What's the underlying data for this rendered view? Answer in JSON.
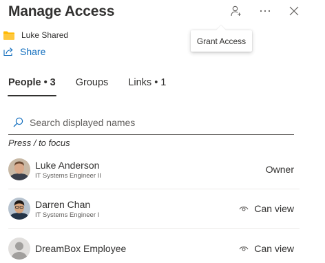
{
  "header": {
    "title": "Manage Access",
    "grant_access_tooltip": "Grant Access",
    "icons": {
      "grant": "person-add-icon",
      "more": "more-icon",
      "close": "close-icon"
    }
  },
  "item": {
    "folder_name": "Luke Shared",
    "share_label": "Share",
    "folder_color": "#ffb900"
  },
  "tabs": [
    {
      "label": "People • 3",
      "active": true
    },
    {
      "label": "Groups",
      "active": false
    },
    {
      "label": "Links • 1",
      "active": false
    }
  ],
  "search": {
    "placeholder": "Search displayed names",
    "hint": "Press / to focus"
  },
  "people": [
    {
      "name": "Luke Anderson",
      "title": "IT Systems Engineer II",
      "permission": "Owner",
      "has_view_icon": false
    },
    {
      "name": "Darren Chan",
      "title": "IT Systems Engineer I",
      "permission": "Can view",
      "has_view_icon": true
    },
    {
      "name": "DreamBox Employee",
      "title": "",
      "permission": "Can view",
      "has_view_icon": true
    }
  ],
  "colors": {
    "accent": "#0f6cbd",
    "text": "#323130",
    "subtle": "#605e5c"
  }
}
